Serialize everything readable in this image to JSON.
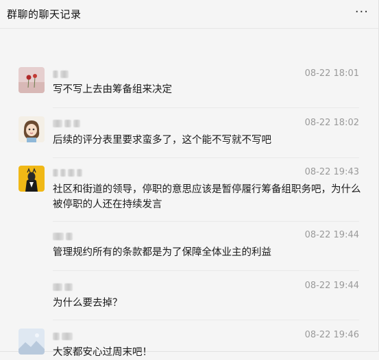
{
  "window": {
    "title": "群聊的聊天记录",
    "more_label": "···"
  },
  "messages": [
    {
      "time": "08-22 18:01",
      "text": "写不写上去由筹备组来决定"
    },
    {
      "time": "08-22 18:02",
      "text": "后续的评分表里要求蛮多了，这个能不写就不写吧"
    },
    {
      "time": "08-22 19:43",
      "text": "社区和街道的领导，停职的意思应该是暂停履行筹备组职务吧，为什么被停职的人还在持续发言"
    },
    {
      "time": "08-22 19:44",
      "text": "管理规约所有的条款都是为了保障全体业主的利益"
    },
    {
      "time": "08-22 19:44",
      "text": "为什么要去掉？"
    },
    {
      "time": "08-22 19:46",
      "text": "大家都安心过周末吧！"
    }
  ]
}
